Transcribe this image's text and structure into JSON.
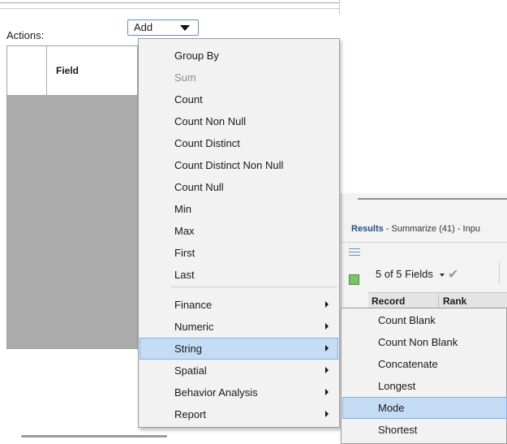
{
  "config": {
    "actions_label": "Actions:",
    "add_button_label": "Add",
    "grid": {
      "field_header": "Field"
    }
  },
  "menu": {
    "items": [
      {
        "label": "Group By",
        "disabled": false
      },
      {
        "label": "Sum",
        "disabled": true
      },
      {
        "label": "Count",
        "disabled": false
      },
      {
        "label": "Count Non Null",
        "disabled": false
      },
      {
        "label": "Count Distinct",
        "disabled": false
      },
      {
        "label": "Count Distinct Non Null",
        "disabled": false
      },
      {
        "label": "Count Null",
        "disabled": false
      },
      {
        "label": "Min",
        "disabled": false
      },
      {
        "label": "Max",
        "disabled": false
      },
      {
        "label": "First",
        "disabled": false
      },
      {
        "label": "Last",
        "disabled": false
      }
    ],
    "submenus": [
      {
        "label": "Finance",
        "has_submenu": true
      },
      {
        "label": "Numeric",
        "has_submenu": true
      },
      {
        "label": "String",
        "has_submenu": true,
        "highlighted": true
      },
      {
        "label": "Spatial",
        "has_submenu": true
      },
      {
        "label": "Behavior Analysis",
        "has_submenu": true
      },
      {
        "label": "Report",
        "has_submenu": true
      }
    ]
  },
  "string_submenu": {
    "items": [
      {
        "label": "Count Blank"
      },
      {
        "label": "Count Non Blank"
      },
      {
        "label": "Concatenate"
      },
      {
        "label": "Longest"
      },
      {
        "label": "Mode",
        "highlighted": true
      },
      {
        "label": "Shortest"
      }
    ]
  },
  "results": {
    "title_bold": "Results",
    "title_rest": " - Summarize (41) - Inpu",
    "fields_count": "5 of 5 Fields",
    "columns": [
      "Record",
      "Rank"
    ]
  },
  "colors": {
    "highlight_bg": "#c5dcf5",
    "highlight_border": "#7fb1e6",
    "menu_bg": "#f2f2f2",
    "grid_body": "#ababab",
    "results_title_accent": "#1f4e8c"
  },
  "icons": {
    "add_dropdown": "chevron-down-icon",
    "submenu_arrow": "chevron-right-icon",
    "apply": "checkmark-icon",
    "fields_list": "list-icon",
    "status": "green-square-icon"
  }
}
